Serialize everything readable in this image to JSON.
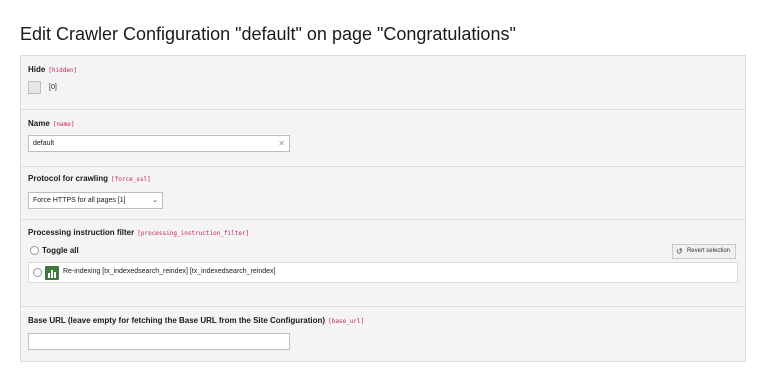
{
  "page": {
    "title": "Edit Crawler Configuration \"default\" on page \"Congratulations\""
  },
  "fields": {
    "hide": {
      "label": "Hide",
      "key": "[hidden]",
      "value": "[0]"
    },
    "name": {
      "label": "Name",
      "key": "[name]",
      "value": "default",
      "clear_icon": "close-icon"
    },
    "protocol": {
      "label": "Protocol for crawling",
      "key": "[force_ssl]",
      "selected": "Force HTTPS for all pages [1]"
    },
    "processing": {
      "label": "Processing instruction filter",
      "key": "[processing_instruction_filter]",
      "toggle_all": "Toggle all",
      "revert_label": "Revert selection",
      "options": [
        {
          "label": "Re-indexing [tx_indexedsearch_reindex] [tx_indexedsearch_reindex]",
          "icon": "chart-icon",
          "icon_color": "#3d7a3d",
          "checked": false
        }
      ]
    },
    "base_url": {
      "label": "Base URL (leave empty for fetching the Base URL from the Site Configuration)",
      "key": "[base_url]",
      "value": ""
    }
  }
}
